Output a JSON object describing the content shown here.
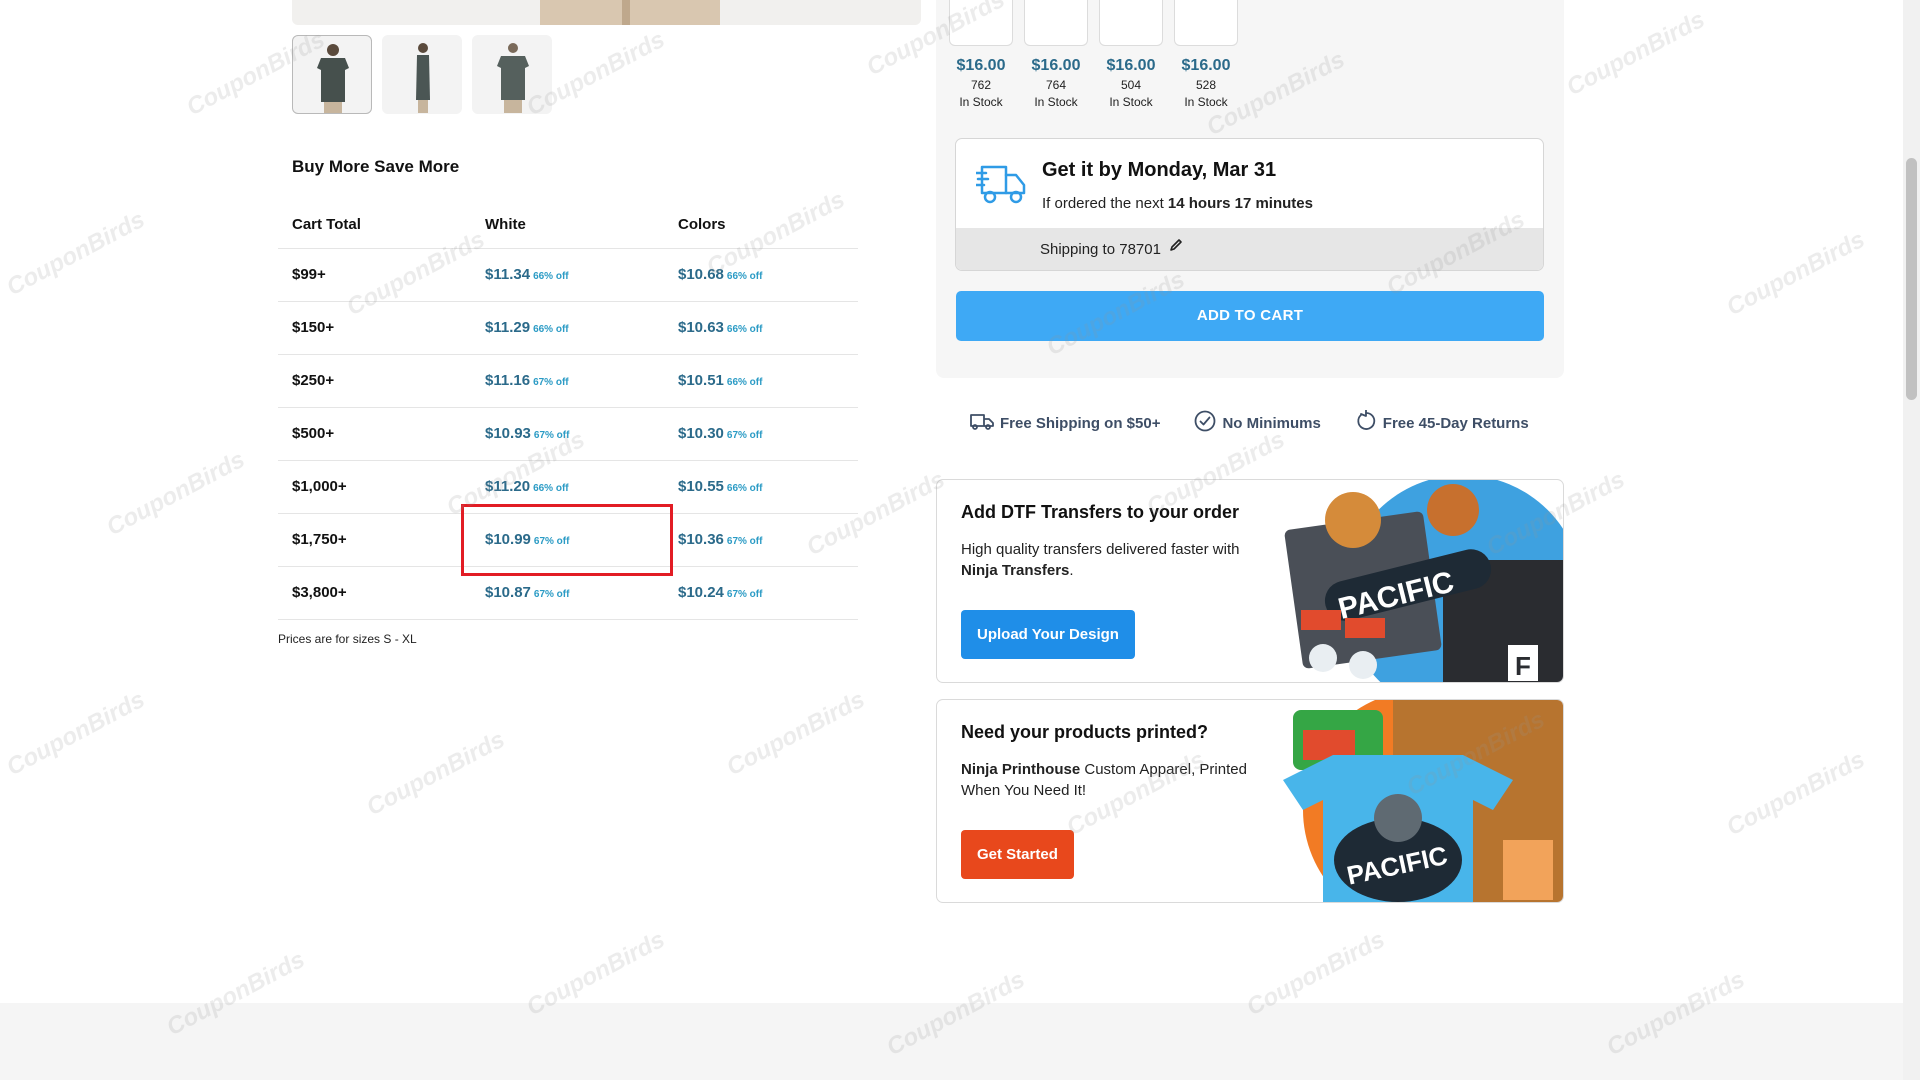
{
  "gallery": {
    "thumbnails": [
      "thumbnail-front",
      "thumbnail-side",
      "thumbnail-back"
    ]
  },
  "bulk_pricing": {
    "title": "Buy More Save More",
    "headers": [
      "Cart Total",
      "White",
      "Colors"
    ],
    "rows": [
      {
        "tier": "$99+",
        "white_price": "$11.34",
        "white_off": "66% off",
        "colors_price": "$10.68",
        "colors_off": "66% off"
      },
      {
        "tier": "$150+",
        "white_price": "$11.29",
        "white_off": "66% off",
        "colors_price": "$10.63",
        "colors_off": "66% off"
      },
      {
        "tier": "$250+",
        "white_price": "$11.16",
        "white_off": "67% off",
        "colors_price": "$10.51",
        "colors_off": "66% off"
      },
      {
        "tier": "$500+",
        "white_price": "$10.93",
        "white_off": "67% off",
        "colors_price": "$10.30",
        "colors_off": "67% off"
      },
      {
        "tier": "$1,000+",
        "white_price": "$11.20",
        "white_off": "66% off",
        "colors_price": "$10.55",
        "colors_off": "66% off"
      },
      {
        "tier": "$1,750+",
        "white_price": "$10.99",
        "white_off": "67% off",
        "colors_price": "$10.36",
        "colors_off": "67% off"
      },
      {
        "tier": "$3,800+",
        "white_price": "$10.87",
        "white_off": "67% off",
        "colors_price": "$10.24",
        "colors_off": "67% off"
      }
    ],
    "note": "Prices are for sizes S - XL"
  },
  "sizes": [
    {
      "price": "$16.00",
      "qty": "762",
      "stock": "In Stock"
    },
    {
      "price": "$16.00",
      "qty": "764",
      "stock": "In Stock"
    },
    {
      "price": "$16.00",
      "qty": "504",
      "stock": "In Stock"
    },
    {
      "price": "$16.00",
      "qty": "528",
      "stock": "In Stock"
    }
  ],
  "delivery": {
    "title": "Get it by Monday, Mar 31",
    "sub_prefix": "If ordered the next",
    "sub_time": "14 hours 17 minutes",
    "shipping": "Shipping to 78701"
  },
  "cart": {
    "add_label": "ADD TO CART"
  },
  "perks": [
    {
      "label": "Free Shipping on $50+",
      "icon": "truck-icon"
    },
    {
      "label": "No Minimums",
      "icon": "check-circle-icon"
    },
    {
      "label": "Free 45-Day Returns",
      "icon": "refresh-icon"
    }
  ],
  "promo_dtf": {
    "title": "Add DTF Transfers to your order",
    "text_prefix": "High quality transfers delivered faster with",
    "text_bold": "Ninja Transfers",
    "text_suffix": ".",
    "button": "Upload Your Design",
    "art_text": "PACIFIC"
  },
  "promo_print": {
    "title": "Need your products printed?",
    "text_bold": "Ninja Printhouse",
    "text_rest": " Custom Apparel, Printed When You Need It!",
    "button": "Get Started",
    "art_text": "PACIFIC"
  },
  "watermark": "CouponBirds",
  "colors": {
    "accent": "#3ea9f5",
    "price": "#2b6a8a",
    "discount": "#2b9bc5",
    "highlight": "#e21c24",
    "dtf_button": "#1f8ee8",
    "print_button": "#e8481c"
  }
}
